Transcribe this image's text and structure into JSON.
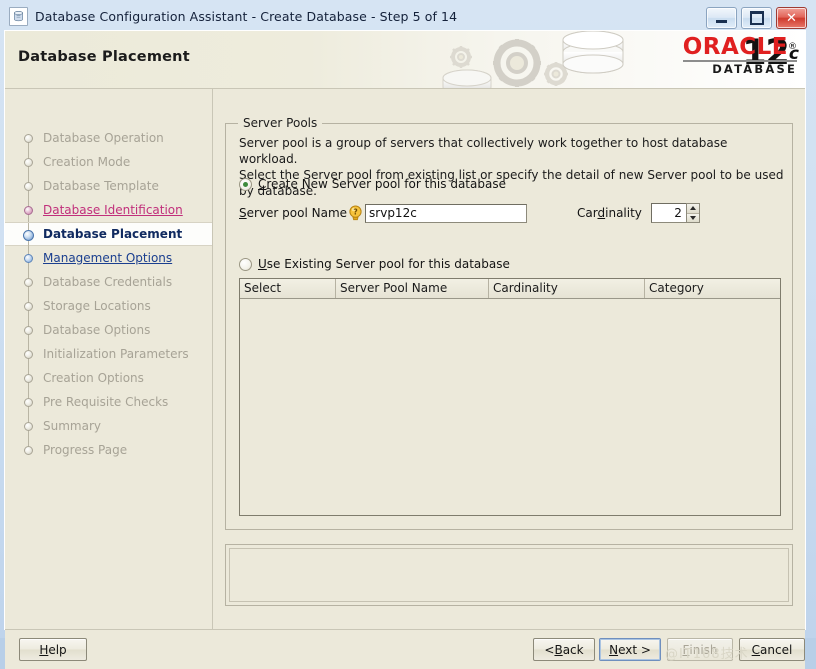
{
  "window": {
    "title": "Database Configuration Assistant - Create Database - Step 5 of 14",
    "app_icon": "database-assistant-icon",
    "minimize_label": "",
    "maximize_label": "",
    "close_label": "✕"
  },
  "banner": {
    "title": "Database Placement",
    "logo": {
      "brand": "ORACLE",
      "registered": "®",
      "product": "DATABASE",
      "version_number": "12",
      "version_suffix": "c"
    }
  },
  "sidebar": {
    "items": [
      {
        "label": "Database Operation",
        "state": "pending"
      },
      {
        "label": "Creation Mode",
        "state": "pending"
      },
      {
        "label": "Database Template",
        "state": "pending"
      },
      {
        "label": "Database Identification",
        "state": "done"
      },
      {
        "label": "Database Placement",
        "state": "current"
      },
      {
        "label": "Management Options",
        "state": "next"
      },
      {
        "label": "Database Credentials",
        "state": "pending"
      },
      {
        "label": "Storage Locations",
        "state": "pending"
      },
      {
        "label": "Database Options",
        "state": "pending"
      },
      {
        "label": "Initialization Parameters",
        "state": "pending"
      },
      {
        "label": "Creation Options",
        "state": "pending"
      },
      {
        "label": "Pre Requisite Checks",
        "state": "pending"
      },
      {
        "label": "Summary",
        "state": "pending"
      },
      {
        "label": "Progress Page",
        "state": "pending"
      }
    ]
  },
  "main": {
    "group_title": "Server Pools",
    "description_line1": "Server pool is a group of servers that collectively work together to host database workload.",
    "description_line2": "Select the Server pool from existing list or specify the detail of new Server pool to be used by database.",
    "option_create": {
      "label_prefix": "C",
      "label_rest": "reate New Server pool for this database",
      "selected": true
    },
    "option_existing": {
      "label_prefix": "U",
      "label_rest": "se Existing Server pool for this database",
      "selected": false
    },
    "pool_name": {
      "label_prefix": "S",
      "label_mid": "erver pool Name",
      "value": "srvp12c",
      "placeholder": "",
      "tip_icon": "tip-bulb-icon"
    },
    "cardinality": {
      "label_prefix": "Car",
      "label_mid": "d",
      "label_rest": "inality",
      "value": "2"
    },
    "table": {
      "columns": [
        "Select",
        "Server Pool Name",
        "Cardinality",
        "Category"
      ],
      "rows": []
    },
    "message_panel_text": ""
  },
  "buttons": {
    "help": {
      "prefix": "",
      "mn": "H",
      "rest": "elp",
      "enabled": true,
      "focused": false
    },
    "back": {
      "prefix": "< ",
      "mn": "B",
      "rest": "ack",
      "enabled": true,
      "focused": false
    },
    "next": {
      "prefix": "",
      "mn": "N",
      "rest": "ext >",
      "enabled": true,
      "focused": true
    },
    "finish": {
      "prefix": "",
      "mn": "F",
      "rest": "inish",
      "enabled": false,
      "focused": false
    },
    "cancel": {
      "prefix": "",
      "mn": "C",
      "rest": "ancel",
      "enabled": true,
      "focused": false
    }
  },
  "watermark": "@IT168技术",
  "colors": {
    "panel": "#ece9da",
    "accent_red": "#e02020",
    "link_done": "#c12f7b",
    "link_next": "#1b3f8f",
    "radio_dot": "#3d8b3d"
  }
}
